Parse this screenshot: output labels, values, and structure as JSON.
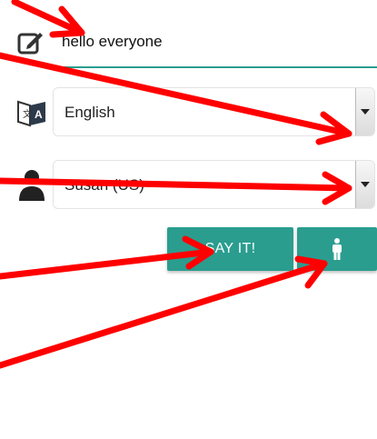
{
  "form": {
    "text_value": "hello everyone",
    "language_value": "English",
    "voice_value": "Susan (US)",
    "say_label": "SAY IT!"
  },
  "icons": {
    "edit": "pencil-square-icon",
    "language": "translate-icon",
    "voice": "person-silhouette-icon",
    "button_person": "standing-person-icon"
  },
  "colors": {
    "accent": "#2a9d8f",
    "annotation": "#ff0000"
  }
}
